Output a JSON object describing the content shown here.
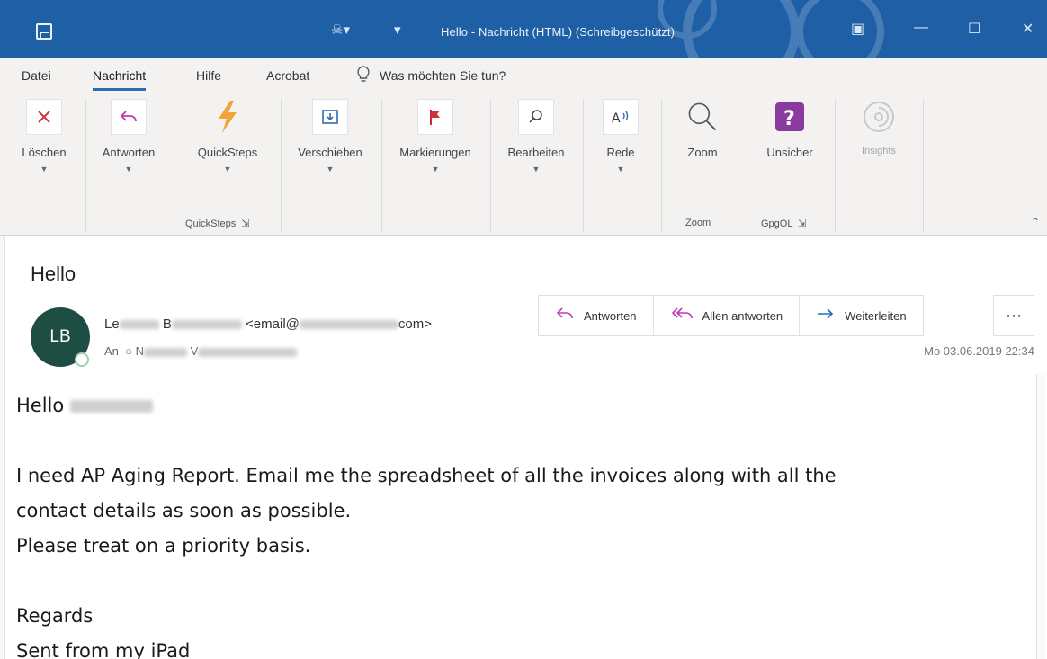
{
  "window": {
    "title": "Hello  -  Nachricht (HTML) (Schreibgeschützt)",
    "colors": {
      "titlebar": "#1f5fa6",
      "ribbon": "#f3f2f1",
      "avatar": "#1e4e43",
      "accent": "#2b6cb4"
    }
  },
  "tabs": [
    {
      "label": "Datei"
    },
    {
      "label": "Nachricht",
      "active": true
    },
    {
      "label": "Hilfe"
    },
    {
      "label": "Acrobat"
    }
  ],
  "tell_me": {
    "placeholder": "Was möchten Sie tun?"
  },
  "ribbon": {
    "buttons": [
      {
        "label": "Löschen",
        "icon": "delete-x-icon"
      },
      {
        "label": "Antworten",
        "icon": "reply-icon"
      },
      {
        "label": "QuickSteps",
        "icon": "lightning-icon"
      },
      {
        "label": "Verschieben",
        "icon": "move-icon"
      },
      {
        "label": "Markierungen",
        "icon": "flag-icon"
      },
      {
        "label": "Bearbeiten",
        "icon": "search-icon"
      },
      {
        "label": "Rede",
        "icon": "read-aloud-icon"
      },
      {
        "label": "Zoom",
        "icon": "zoom-icon"
      },
      {
        "label": "Unsicher",
        "icon": "question-icon"
      },
      {
        "label": "Insights",
        "icon": "insights-icon",
        "disabled": true
      }
    ],
    "groups": [
      {
        "label": "QuickSteps"
      },
      {
        "label": "Zoom"
      },
      {
        "label": "GpgOL"
      }
    ]
  },
  "message": {
    "subject": "Hello",
    "avatar_initials": "LB",
    "sender_first": "Le",
    "sender_last": "B",
    "sender_email_start": "<email@",
    "sender_email_end": "com>",
    "to_label": "An",
    "to_initial": "N",
    "to_second": "V",
    "date": "Mo 03.06.2019 22:34",
    "actions": [
      {
        "label": "Antworten",
        "icon": "reply-icon"
      },
      {
        "label": "Allen antworten",
        "icon": "reply-all-icon"
      },
      {
        "label": "Weiterleiten",
        "icon": "forward-arrow-icon"
      }
    ],
    "body": {
      "greeting": "Hello",
      "line1": "I need AP Aging Report. Email me the spreadsheet of all the invoices along with all the",
      "line2": "contact details as soon as possible.",
      "line3": "Please treat on a priority basis.",
      "closing": "Regards",
      "signature": "Sent from my iPad"
    }
  }
}
